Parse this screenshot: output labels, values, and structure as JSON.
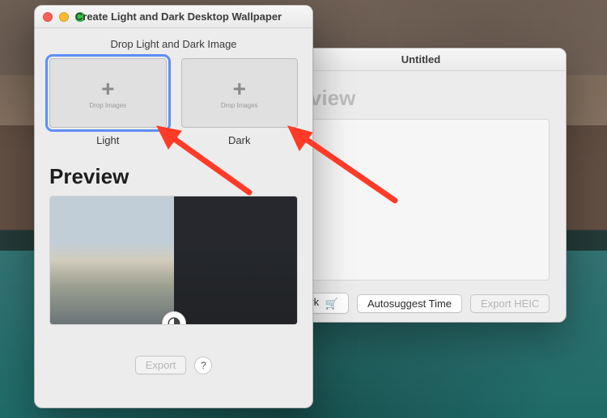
{
  "front_window": {
    "title": "Create Light and Dark Desktop Wallpaper",
    "drop_title": "Drop Light and Dark Image",
    "light": {
      "label": "Light",
      "placeholder": "Drop Images"
    },
    "dark": {
      "label": "Dark",
      "placeholder": "Drop Images"
    },
    "preview_heading": "Preview",
    "export_label": "Export",
    "help_label": "?"
  },
  "back_window": {
    "title": "Untitled",
    "preview_heading": "Preview",
    "watermark_label": "ermark",
    "autosuggest_label": "Autosuggest Time",
    "export_heic_label": "Export HEIC"
  },
  "icons": {
    "plus": "+",
    "cart": "🛒",
    "contrast": "◐"
  },
  "colors": {
    "arrow": "#ff3b28",
    "selection": "#5e8df8"
  }
}
